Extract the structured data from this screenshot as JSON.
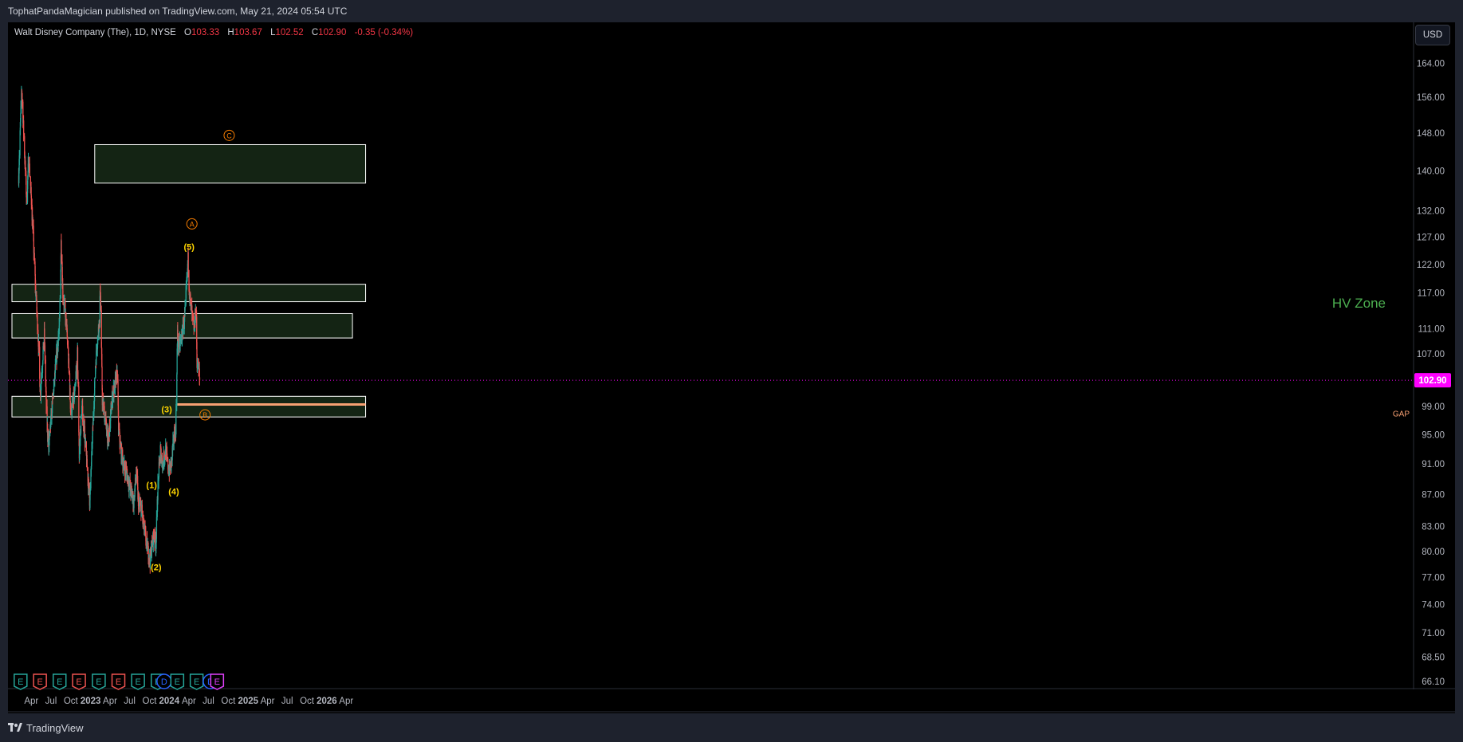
{
  "publish_header": "TophatPandaMagician published on TradingView.com, May 21, 2024 05:54 UTC",
  "legend": {
    "symbol": "Walt Disney Company (The), 1D, NYSE",
    "open_label": "O",
    "open": "103.33",
    "high_label": "H",
    "high": "103.67",
    "low_label": "L",
    "low": "102.52",
    "close_label": "C",
    "close": "102.90",
    "change": "-0.35 (-0.34%)"
  },
  "currency": "USD",
  "footer_brand": "TradingView",
  "colors": {
    "up": "#26a69a",
    "down": "#ef5350",
    "zone_fill": "#142414",
    "zone_border": "#ffffff",
    "gap_line": "#f7a072",
    "wave_minor": "#ffd600",
    "wave_major": "#f57c00",
    "price_tag": "#ff00ff",
    "hv_text": "#4caf50"
  },
  "chart_data": {
    "type": "candlestick",
    "title": "",
    "y_scale": "log",
    "y_ticks": [
      "164.00",
      "156.00",
      "148.00",
      "140.00",
      "132.00",
      "127.00",
      "122.00",
      "117.00",
      "111.00",
      "107.00",
      "99.00",
      "95.00",
      "91.00",
      "87.00",
      "83.00",
      "80.00",
      "77.00",
      "74.00",
      "71.00",
      "68.50",
      "66.10"
    ],
    "x_ticks": [
      "Apr",
      "Jul",
      "Oct",
      "2023",
      "Apr",
      "Jul",
      "Oct",
      "2024",
      "Apr",
      "Jul",
      "Oct",
      "2025",
      "Apr",
      "Jul",
      "Oct",
      "2026",
      "Apr"
    ],
    "last_price": "102.90",
    "price_path": [
      [
        "2022-02-01",
        139
      ],
      [
        "2022-02-15",
        158
      ],
      [
        "2022-03-01",
        143
      ],
      [
        "2022-03-10",
        134
      ],
      [
        "2022-03-20",
        143
      ],
      [
        "2022-04-01",
        134
      ],
      [
        "2022-04-20",
        118
      ],
      [
        "2022-05-05",
        108
      ],
      [
        "2022-05-12",
        101
      ],
      [
        "2022-05-31",
        110
      ],
      [
        "2022-06-10",
        98
      ],
      [
        "2022-06-20",
        93
      ],
      [
        "2022-07-01",
        97
      ],
      [
        "2022-07-20",
        104
      ],
      [
        "2022-08-10",
        112
      ],
      [
        "2022-08-17",
        126
      ],
      [
        "2022-08-25",
        117
      ],
      [
        "2022-09-10",
        112
      ],
      [
        "2022-09-20",
        106
      ],
      [
        "2022-10-01",
        98
      ],
      [
        "2022-10-20",
        101
      ],
      [
        "2022-11-01",
        107
      ],
      [
        "2022-11-09",
        92
      ],
      [
        "2022-11-21",
        99
      ],
      [
        "2022-12-01",
        96
      ],
      [
        "2022-12-28",
        86
      ],
      [
        "2023-01-10",
        95
      ],
      [
        "2023-01-25",
        106
      ],
      [
        "2023-02-09",
        112
      ],
      [
        "2023-02-15",
        118
      ],
      [
        "2023-02-24",
        100
      ],
      [
        "2023-03-10",
        97
      ],
      [
        "2023-03-24",
        94
      ],
      [
        "2023-04-10",
        100
      ],
      [
        "2023-05-05",
        104
      ],
      [
        "2023-05-10",
        96
      ],
      [
        "2023-05-20",
        93
      ],
      [
        "2023-06-01",
        91
      ],
      [
        "2023-06-15",
        90
      ],
      [
        "2023-07-01",
        88
      ],
      [
        "2023-07-20",
        86
      ],
      [
        "2023-08-01",
        90
      ],
      [
        "2023-08-10",
        86
      ],
      [
        "2023-08-25",
        85
      ],
      [
        "2023-09-10",
        82
      ],
      [
        "2023-09-25",
        80
      ],
      [
        "2023-10-03",
        79
      ],
      [
        "2023-10-20",
        82
      ],
      [
        "2023-10-31",
        81
      ],
      [
        "2023-11-09",
        88
      ],
      [
        "2023-11-20",
        93
      ],
      [
        "2023-12-01",
        91
      ],
      [
        "2023-12-15",
        93
      ],
      [
        "2023-12-29",
        90
      ],
      [
        "2024-01-10",
        91
      ],
      [
        "2024-01-20",
        94
      ],
      [
        "2024-01-31",
        96
      ],
      [
        "2024-02-08",
        110
      ],
      [
        "2024-02-15",
        108
      ],
      [
        "2024-03-01",
        110
      ],
      [
        "2024-03-15",
        114
      ],
      [
        "2024-03-28",
        123
      ],
      [
        "2024-04-05",
        116
      ],
      [
        "2024-04-15",
        113
      ],
      [
        "2024-04-25",
        111
      ],
      [
        "2024-05-05",
        115
      ],
      [
        "2024-05-08",
        106
      ],
      [
        "2024-05-14",
        105
      ],
      [
        "2024-05-21",
        102.9
      ]
    ],
    "zones": [
      {
        "from": "2023-01-20",
        "to": "2026-06-30",
        "low": 137.5,
        "high": 145.5
      },
      {
        "from": "2022-01-01",
        "to": "2026-06-30",
        "low": 115.5,
        "high": 118.5
      },
      {
        "from": "2022-01-01",
        "to": "2026-04-30",
        "low": 109.5,
        "high": 113.5
      },
      {
        "from": "2022-01-01",
        "to": "2026-06-30",
        "low": 97.5,
        "high": 100.5
      }
    ],
    "gap": {
      "from": "2024-02-07",
      "to": "2026-06-30",
      "price": 99.3,
      "label": "GAP"
    },
    "hv_zone_label": "HV Zone",
    "wave_labels": [
      {
        "label": "(1)",
        "date": "2023-10-11",
        "price": 88.2
      },
      {
        "label": "(2)",
        "date": "2023-11-01",
        "price": 78.2
      },
      {
        "label": "(3)",
        "date": "2023-12-20",
        "price": 98.6
      },
      {
        "label": "(4)",
        "date": "2024-01-22",
        "price": 87.4
      },
      {
        "label": "(5)",
        "date": "2024-04-02",
        "price": 125.2
      },
      {
        "label": "A",
        "date": "2024-04-15",
        "price": 129.5
      },
      {
        "label": "B",
        "date": "2024-06-15",
        "price": 97.8
      },
      {
        "label": "C",
        "date": "2024-10-05",
        "price": 147.5
      }
    ],
    "events": [
      {
        "type": "E",
        "date": "2022-02-10",
        "color": "#26a69a"
      },
      {
        "type": "E",
        "date": "2022-05-11",
        "color": "#ef5350"
      },
      {
        "type": "E",
        "date": "2022-08-10",
        "color": "#26a69a"
      },
      {
        "type": "E",
        "date": "2022-11-08",
        "color": "#ef5350"
      },
      {
        "type": "E",
        "date": "2023-02-08",
        "color": "#26a69a"
      },
      {
        "type": "E",
        "date": "2023-05-10",
        "color": "#ef5350"
      },
      {
        "type": "E",
        "date": "2023-08-09",
        "color": "#26a69a"
      },
      {
        "type": "E",
        "date": "2023-11-08",
        "color": "#26a69a"
      },
      {
        "type": "D",
        "date": "2023-12-08",
        "color": "#2962ff"
      },
      {
        "type": "E",
        "date": "2024-02-07",
        "color": "#26a69a"
      },
      {
        "type": "E",
        "date": "2024-05-07",
        "color": "#26a69a"
      },
      {
        "type": "D",
        "date": "2024-07-10",
        "color": "#2962ff"
      },
      {
        "type": "E",
        "date": "2024-08-10",
        "color": "#e040fb"
      }
    ]
  }
}
